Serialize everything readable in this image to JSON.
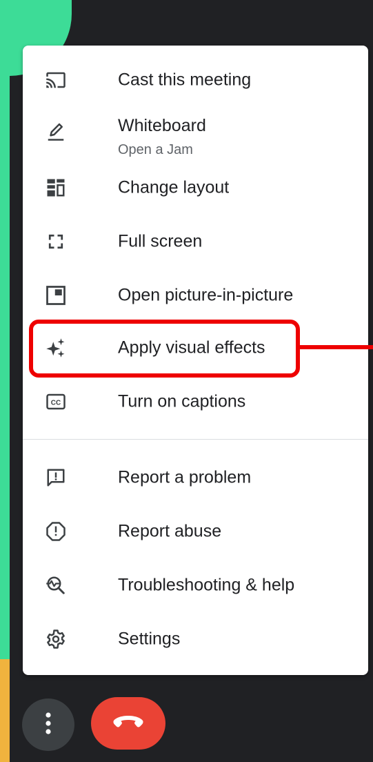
{
  "menu": {
    "items": [
      {
        "label": "Cast this meeting",
        "icon": "cast-icon"
      },
      {
        "label": "Whiteboard",
        "sublabel": "Open a Jam",
        "icon": "pencil-icon"
      },
      {
        "label": "Change layout",
        "icon": "layout-icon"
      },
      {
        "label": "Full screen",
        "icon": "fullscreen-icon"
      },
      {
        "label": "Open picture-in-picture",
        "icon": "picture-in-picture-icon"
      },
      {
        "label": "Apply visual effects",
        "icon": "sparkle-icon"
      },
      {
        "label": "Turn on captions",
        "icon": "closed-captions-icon"
      },
      {
        "label": "Report a problem",
        "icon": "feedback-icon"
      },
      {
        "label": "Report abuse",
        "icon": "report-icon"
      },
      {
        "label": "Troubleshooting & help",
        "icon": "troubleshoot-icon"
      },
      {
        "label": "Settings",
        "icon": "gear-icon"
      }
    ]
  },
  "controls": {
    "more_options_icon": "more-vert-icon",
    "end_call_icon": "end-call-icon"
  },
  "colors": {
    "highlight": "#ee0000",
    "end_call": "#ea4335",
    "background": "#202124",
    "accent_green": "#3ddc97",
    "accent_orange": "#f0b33e"
  }
}
